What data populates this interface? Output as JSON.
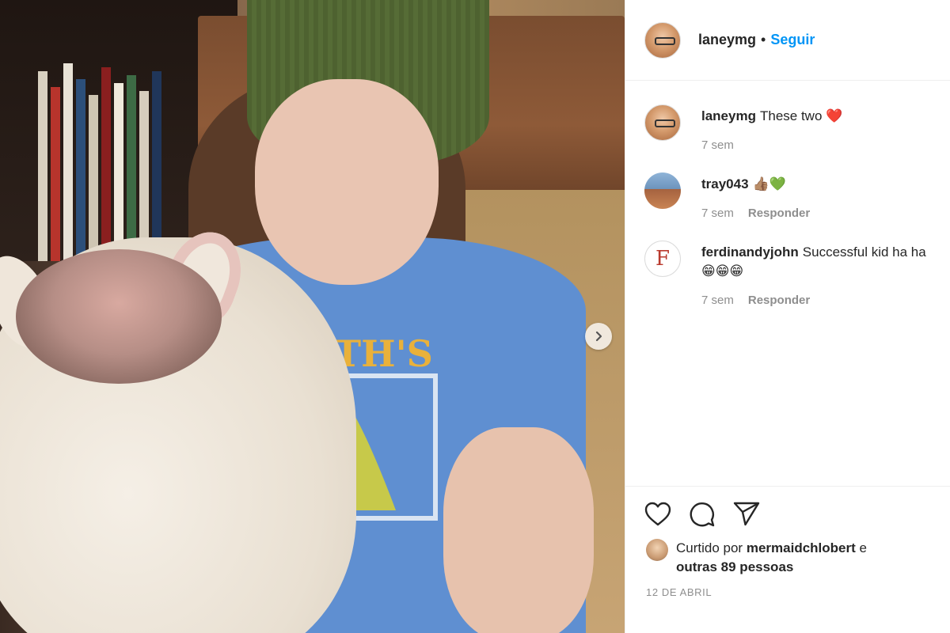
{
  "header": {
    "username": "laneymg",
    "separator": "•",
    "follow_label": "Seguir"
  },
  "comments": [
    {
      "username": "laneymg",
      "text": "These two ❤️",
      "time": "7 sem",
      "reply_label": ""
    },
    {
      "username": "tray043",
      "text": "👍🏽💚",
      "time": "7 sem",
      "reply_label": "Responder"
    },
    {
      "username": "ferdinandyjohn",
      "text": "Successful kid ha ha😁😁😁",
      "time": "7 sem",
      "reply_label": "Responder"
    }
  ],
  "likes": {
    "prefix": "Curtido por",
    "liker": "mermaidchlobert",
    "connector": "e",
    "others": "outras 89 pessoas"
  },
  "post_date": "12 DE ABRIL",
  "shirt_text": "BLUTH'S",
  "avatars": {
    "ferdinandyjohn_letter": "F"
  },
  "icons": {
    "like": "heart-icon",
    "comment": "comment-bubble-icon",
    "share": "paper-plane-icon",
    "carousel": "chevron-right-icon"
  },
  "colors": {
    "accent": "#0095f6",
    "text": "#262626",
    "muted": "#8e8e8e",
    "divider": "#efefef"
  }
}
